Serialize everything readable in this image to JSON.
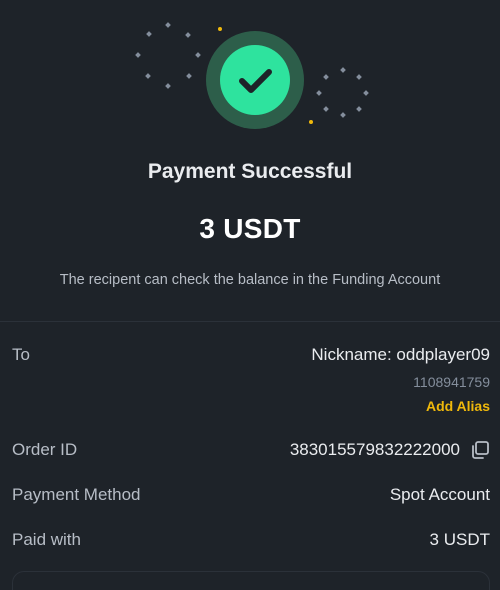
{
  "status": {
    "title": "Payment Successful",
    "amount": "3 USDT",
    "note": "The recipent can check the balance in the Funding Account",
    "icon": "check-icon",
    "accent_color": "#2ee39e"
  },
  "details": {
    "to": {
      "label": "To",
      "nickname": "Nickname: oddplayer09",
      "uid": "1108941759",
      "add_alias": "Add Alias"
    },
    "order": {
      "label": "Order ID",
      "value": "383015579832222000",
      "icon": "copy-icon"
    },
    "payment_method": {
      "label": "Payment Method",
      "value": "Spot Account"
    },
    "paid_with": {
      "label": "Paid with",
      "value": "3 USDT"
    }
  },
  "colors": {
    "background": "#1e2329",
    "link": "#f0b90b",
    "muted_text": "#b7bdc6"
  }
}
